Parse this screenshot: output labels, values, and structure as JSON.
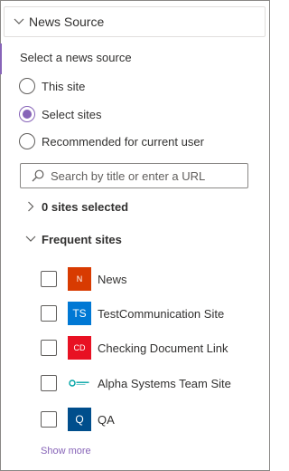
{
  "panel": {
    "title": "News Source",
    "section_label": "Select a news source"
  },
  "options": [
    {
      "label": "This site",
      "checked": false
    },
    {
      "label": "Select sites",
      "checked": true
    },
    {
      "label": "Recommended for current user",
      "checked": false
    }
  ],
  "search": {
    "placeholder": "Search by title or enter a URL"
  },
  "groups": {
    "selected_label": "0 sites selected",
    "frequent_label": "Frequent sites"
  },
  "sites": [
    {
      "name": "News",
      "logo_text": "N",
      "logo_color": "#d83b01",
      "checked": false
    },
    {
      "name": "TestCommunication Site",
      "logo_text": "TS",
      "logo_color": "#0078d4",
      "checked": false
    },
    {
      "name": "Checking Document Link",
      "logo_text": "CD",
      "logo_color": "#e81123",
      "checked": false
    },
    {
      "name": "Alpha Systems Team Site",
      "logo_text": "",
      "logo_color": "#ffffff",
      "checked": false
    },
    {
      "name": "QA",
      "logo_text": "Q",
      "logo_color": "#004e8c",
      "checked": false
    }
  ],
  "footer": {
    "show_more": "Show more"
  },
  "colors": {
    "accent": "#8764b8",
    "border": "#8a8886"
  }
}
